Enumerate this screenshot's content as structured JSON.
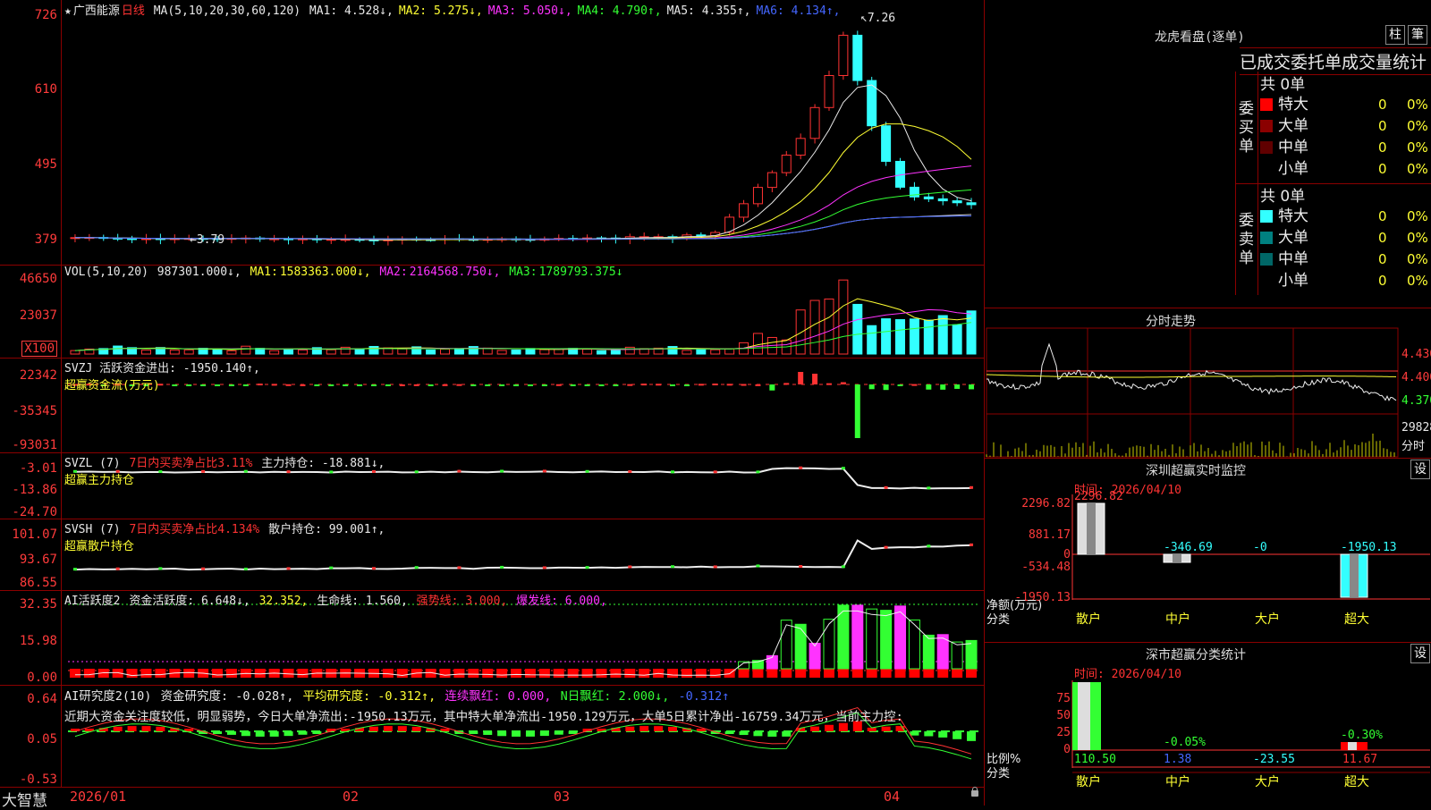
{
  "main": {
    "star": "★",
    "stock_name": "广西能源",
    "period": "日线",
    "ma_label": "MA(5,10,20,30,60,120)",
    "ma_values": [
      {
        "key": "MA1:",
        "val": "4.528",
        "arrow": "↓",
        "color": "#e8e8e8"
      },
      {
        "key": "MA2:",
        "val": "5.275",
        "arrow": "↓",
        "color": "#ffff33"
      },
      {
        "key": "MA3:",
        "val": "5.050",
        "arrow": "↓",
        "color": "#ff33ff"
      },
      {
        "key": "MA4:",
        "val": "4.790",
        "arrow": "↑",
        "color": "#33ff33"
      },
      {
        "key": "MA5:",
        "val": "4.355",
        "arrow": "↑",
        "color": "#e8e8e8"
      },
      {
        "key": "MA6:",
        "val": "4.134",
        "arrow": "↑",
        "color": "#4466ff"
      }
    ],
    "axis": [
      "726",
      "610",
      "495",
      "379"
    ],
    "high_mark": "7.26",
    "low_mark": "3.79"
  },
  "vol": {
    "label": "VOL(5,10,20)",
    "val": "987301.000↓,",
    "ma": [
      {
        "key": "MA1:",
        "val": "1583363.000↓,",
        "color": "#ffff33"
      },
      {
        "key": "MA2:",
        "val": "2164568.750↓,",
        "color": "#ff33ff"
      },
      {
        "key": "MA3:",
        "val": "1789793.375↓",
        "color": "#33ff33"
      }
    ],
    "axis": [
      "46650",
      "23037"
    ],
    "unit": "X100"
  },
  "svzj": {
    "line1": "SVZJ  活跃资金进出: -1950.140↑,",
    "line2": "超赢资金流(万元)",
    "axis": [
      "22342",
      "-35345",
      "-93031"
    ]
  },
  "svzl": {
    "code": "SVZL (7)",
    "desc": "7日内买卖净占比3.11%",
    "val": "主力持仓: -18.881↓,",
    "line2": "超赢主力持仓",
    "axis": [
      "-3.01",
      "-13.86",
      "-24.70"
    ]
  },
  "svsh": {
    "code": "SVSH (7)",
    "desc": "7日内买卖净占比4.134%",
    "val": "散户持仓: 99.001↑,",
    "line2": "超赢散户持仓",
    "axis": [
      "101.07",
      "93.67",
      "86.55"
    ]
  },
  "ai1": {
    "code": "AI活跃度2",
    "a": "资金活跃度: 6.648↓,",
    "b": "32.352,",
    "c": "生命线: 1.560,",
    "d": "强势线: 3.000,",
    "e": "爆发线: 6.000,",
    "axis": [
      "32.35",
      "15.98",
      "0.00"
    ]
  },
  "ai2": {
    "code": "AI研究度2(10)",
    "a": "资金研究度: -0.028↑,",
    "b": "平均研究度: -0.312↑,",
    "c": "连续飘红: 0.000,",
    "d": "N日飘红: 2.000↓,",
    "e": "-0.312↑",
    "text": "近期大资金关注度较低，明显弱势，今日大单净流出:-1950.13万元，其中特大单净流出-1950.129万元，大单5日累计净出-16759.34万元，当前主力控:",
    "axis": [
      "0.64",
      "0.05",
      "-0.53"
    ]
  },
  "bottom": {
    "brand": "大智慧",
    "dates": [
      "2026/01",
      "02",
      "03",
      "04"
    ]
  },
  "lhb": {
    "title": "龙虎看盘(逐单)",
    "btn1": "柱",
    "btn2": "筆",
    "subtitle": "已成交委托单成交量统计",
    "buy": {
      "side": "委买单",
      "total": "共 0单",
      "rows": [
        {
          "name": "特大",
          "val": "0",
          "pct": "0%",
          "color": "#ff0000"
        },
        {
          "name": "大单",
          "val": "0",
          "pct": "0%",
          "color": "#8b0000"
        },
        {
          "name": "中单",
          "val": "0",
          "pct": "0%",
          "color": "#600000"
        },
        {
          "name": "小单",
          "val": "0",
          "pct": "0%",
          "color": ""
        }
      ]
    },
    "sell": {
      "side": "委卖单",
      "total": "共 0单",
      "rows": [
        {
          "name": "特大",
          "val": "0",
          "pct": "0%",
          "color": "#33ffff"
        },
        {
          "name": "大单",
          "val": "0",
          "pct": "0%",
          "color": "#008080"
        },
        {
          "name": "中单",
          "val": "0",
          "pct": "0%",
          "color": "#006666"
        },
        {
          "name": "小单",
          "val": "0",
          "pct": "0%",
          "color": ""
        }
      ]
    }
  },
  "fenshi": {
    "title": "分时走势",
    "prices": [
      "4.430",
      "4.400",
      "4.370"
    ],
    "vol": "29828",
    "vol_label": "分时"
  },
  "monitor": {
    "title": "深圳超赢实时监控",
    "btn": "设",
    "time": "时间: 2026/04/10",
    "top": "2296.82",
    "axis": [
      "2296.82",
      "881.17",
      "0",
      "-534.48",
      "-1950.13"
    ],
    "bars": [
      "-346.69",
      "-0",
      "-1950.13"
    ],
    "unit1": "净额(万元)",
    "unit2": "分类",
    "cats": [
      "散户",
      "中户",
      "大户",
      "超大"
    ]
  },
  "classify": {
    "title": "深市超赢分类统计",
    "btn": "设",
    "time": "时间: 2026/04/10",
    "axis": [
      "75",
      "50",
      "25",
      "0"
    ],
    "bars": [
      "-0.05%",
      "-0.30%"
    ],
    "unit1": "比例%",
    "unit2": "分类",
    "values": [
      "110.50",
      "1.38",
      "-23.55",
      "11.67"
    ],
    "cats": [
      "散户",
      "中户",
      "大户",
      "超大"
    ]
  }
}
